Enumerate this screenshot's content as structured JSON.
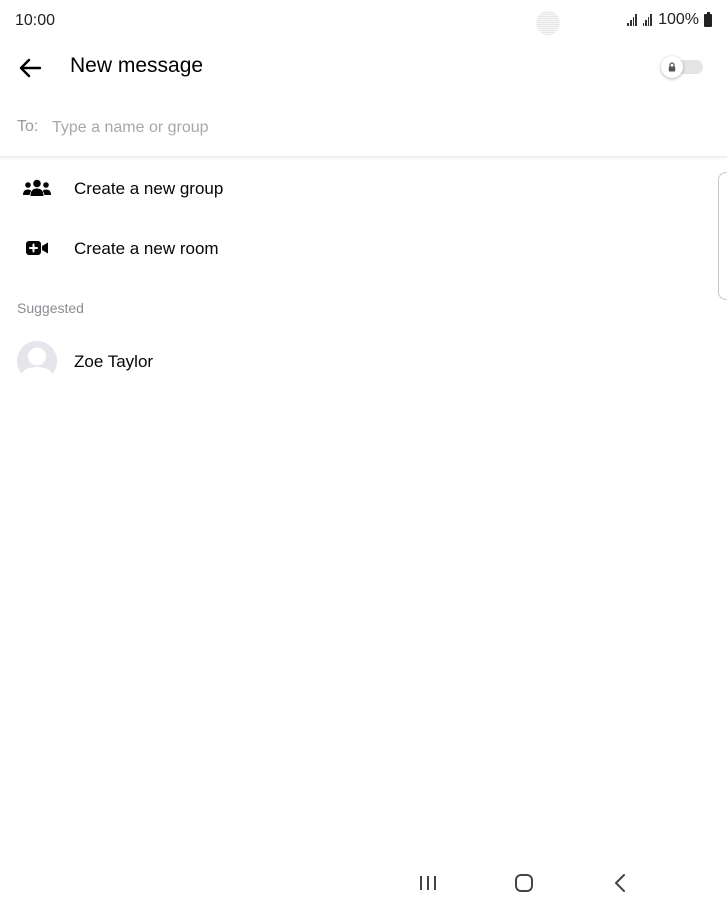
{
  "status_bar": {
    "time": "10:00",
    "battery": "100%"
  },
  "header": {
    "title": "New message",
    "back_icon": "arrow-left-icon",
    "toggle_icon": "lock-icon",
    "toggle_on": false
  },
  "to_field": {
    "label": "To:",
    "placeholder": "Type a name or group",
    "value": ""
  },
  "actions": [
    {
      "label": "Create a new group",
      "icon": "group-icon"
    },
    {
      "label": "Create a new room",
      "icon": "video-plus-icon"
    }
  ],
  "suggested": {
    "header": "Suggested",
    "contacts": [
      {
        "name": "Zoe Taylor",
        "avatar": "default-avatar"
      }
    ]
  },
  "nav_bar": {
    "buttons": [
      "recents-icon",
      "home-icon",
      "back-icon"
    ]
  },
  "colors": {
    "placeholder": "#a8a8a8",
    "section_header": "#8a8d91",
    "text": "#050505"
  }
}
